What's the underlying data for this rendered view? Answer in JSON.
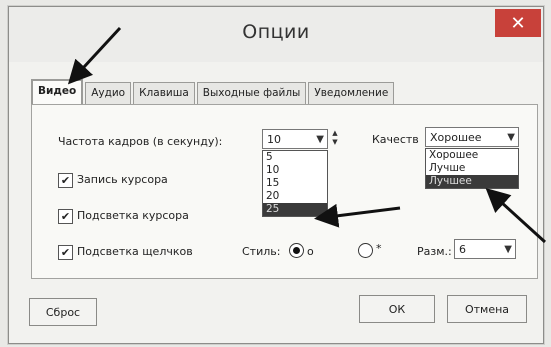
{
  "window": {
    "title": "Опции",
    "close_glyph": "✕"
  },
  "tabs": [
    {
      "label": "Видео",
      "active": true
    },
    {
      "label": "Аудио"
    },
    {
      "label": "Клавиша"
    },
    {
      "label": "Выходные файлы"
    },
    {
      "label": "Уведомление"
    }
  ],
  "video": {
    "fps_label": "Частота кадров (в секунду):",
    "fps_value": "10",
    "fps_options": [
      "5",
      "10",
      "15",
      "20",
      "25"
    ],
    "fps_highlighted": "25",
    "quality_label": "Качеств",
    "quality_value": "Хорошее",
    "quality_options": [
      "Хорошее",
      "Лучше",
      "Лучшее"
    ],
    "quality_highlighted": "Лучшее",
    "record_cursor_label": "Запись курсора",
    "record_cursor_checked_glyph": "✔",
    "highlight_cursor_label": "Подсветка курсора",
    "highlight_cursor_checked_glyph": "✔",
    "highlight_clicks_label": "Подсветка щелчков",
    "highlight_clicks_checked_glyph": "✔",
    "style_label": "Стиль:",
    "style_option1_symbol": "o",
    "style_option2_symbol": "*",
    "size_label": "Разм.:",
    "size_value": "6"
  },
  "buttons": {
    "reset": "Сброс",
    "ok": "ОК",
    "cancel": "Отмена"
  },
  "icons": {
    "chevron_down": "chevron-down-icon",
    "spin": "spinner-arrows-icon"
  },
  "colors": {
    "close": "#c8413a",
    "selected_option": "#3a3a3a"
  }
}
